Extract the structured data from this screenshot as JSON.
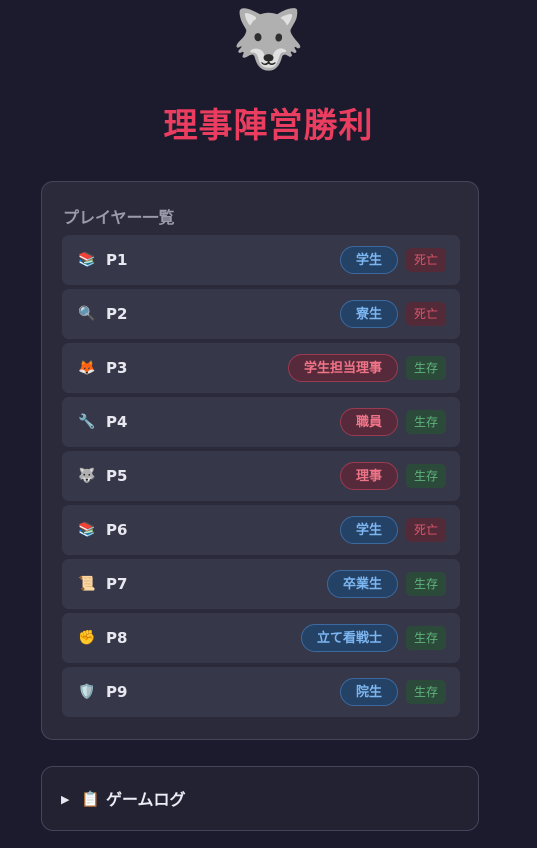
{
  "header": {
    "emoji": "🐺",
    "title": "理事陣営勝利"
  },
  "player_list": {
    "heading": "プレイヤー一覧",
    "players": [
      {
        "icon": "📚",
        "icon_name": "books-icon",
        "name": "P1",
        "role": "学生",
        "role_color": "blue",
        "status": "死亡",
        "status_type": "dead"
      },
      {
        "icon": "🔍",
        "icon_name": "magnifier-icon",
        "name": "P2",
        "role": "寮生",
        "role_color": "blue",
        "status": "死亡",
        "status_type": "dead"
      },
      {
        "icon": "🦊",
        "icon_name": "fox-icon",
        "name": "P3",
        "role": "学生担当理事",
        "role_color": "red",
        "status": "生存",
        "status_type": "alive"
      },
      {
        "icon": "🔧",
        "icon_name": "wrench-icon",
        "name": "P4",
        "role": "職員",
        "role_color": "red",
        "status": "生存",
        "status_type": "alive"
      },
      {
        "icon": "🐺",
        "icon_name": "wolf-icon",
        "name": "P5",
        "role": "理事",
        "role_color": "red",
        "status": "生存",
        "status_type": "alive"
      },
      {
        "icon": "📚",
        "icon_name": "books-icon",
        "name": "P6",
        "role": "学生",
        "role_color": "blue",
        "status": "死亡",
        "status_type": "dead"
      },
      {
        "icon": "📜",
        "icon_name": "scroll-icon",
        "name": "P7",
        "role": "卒業生",
        "role_color": "blue",
        "status": "生存",
        "status_type": "alive"
      },
      {
        "icon": "✊",
        "icon_name": "fist-icon",
        "name": "P8",
        "role": "立て看戦士",
        "role_color": "blue",
        "status": "生存",
        "status_type": "alive"
      },
      {
        "icon": "🛡️",
        "icon_name": "shield-icon",
        "name": "P9",
        "role": "院生",
        "role_color": "blue",
        "status": "生存",
        "status_type": "alive"
      }
    ]
  },
  "game_log": {
    "arrow": "▶",
    "icon": "📋",
    "label": "ゲームログ"
  }
}
